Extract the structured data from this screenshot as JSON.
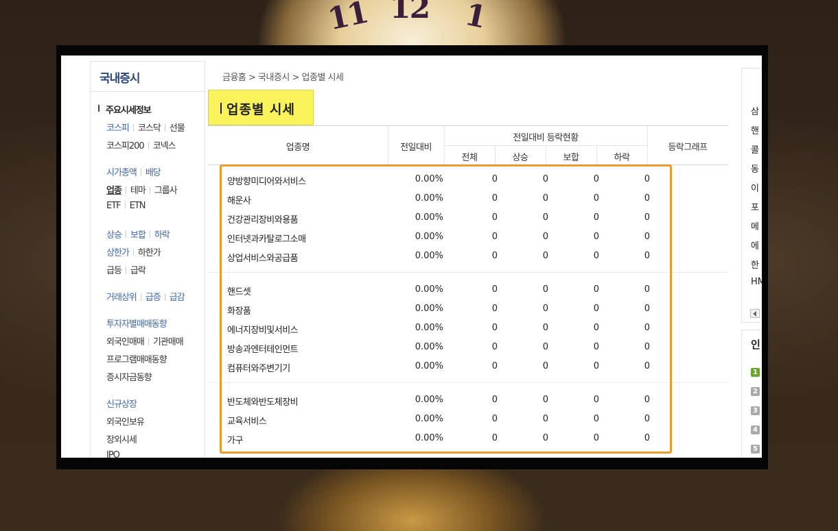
{
  "background": {
    "clock_numerals": [
      "11",
      "12",
      "1"
    ]
  },
  "colors": {
    "accent_blue": "#3b67b0",
    "title_highlight": "#fbf35c",
    "annotation_orange": "#eb9b2d"
  },
  "sidebar": {
    "title": "국내증시",
    "section_head": "주요시세정보",
    "groups": [
      [
        [
          "코스피",
          "코스닥",
          "선물"
        ],
        [
          "코스피200",
          "코넥스"
        ]
      ],
      [
        [
          "시가총액",
          "배당"
        ],
        [
          "업종",
          "테마",
          "그룹사"
        ],
        [
          "ETF",
          "ETN"
        ]
      ],
      [
        [
          "상승",
          "보합",
          "하락"
        ],
        [
          "상한가",
          "하한가"
        ],
        [
          "급등",
          "급락"
        ]
      ],
      [
        [
          "거래상위",
          "급증",
          "급감"
        ]
      ],
      [
        [
          "투자자별매매동향"
        ],
        [
          "외국인매매",
          "기관매매"
        ],
        [
          "프로그램매매동향"
        ],
        [
          "증시자금동향"
        ]
      ],
      [
        [
          "신규상장"
        ],
        [
          "외국인보유"
        ],
        [
          "장외시세"
        ],
        [
          "IPO"
        ]
      ]
    ],
    "selected": "업종"
  },
  "breadcrumb": "금융홈 > 국내증시 > 업종별 시세",
  "page_title": "업종별 시세",
  "table": {
    "headers": {
      "name": "업종명",
      "change": "전일대비",
      "status_group": "전일대비 등락현황",
      "total": "전체",
      "up": "상승",
      "flat": "보합",
      "down": "하락",
      "graph": "등락그래프"
    },
    "groups": [
      [
        {
          "name": "양방향미디어와서비스",
          "change": "0.00%",
          "total": "0",
          "up": "0",
          "flat": "0",
          "down": "0"
        },
        {
          "name": "해운사",
          "change": "0.00%",
          "total": "0",
          "up": "0",
          "flat": "0",
          "down": "0"
        },
        {
          "name": "건강관리장비와용품",
          "change": "0.00%",
          "total": "0",
          "up": "0",
          "flat": "0",
          "down": "0"
        },
        {
          "name": "인터넷과카탈로그소매",
          "change": "0.00%",
          "total": "0",
          "up": "0",
          "flat": "0",
          "down": "0"
        },
        {
          "name": "상업서비스와공급품",
          "change": "0.00%",
          "total": "0",
          "up": "0",
          "flat": "0",
          "down": "0"
        }
      ],
      [
        {
          "name": "핸드셋",
          "change": "0.00%",
          "total": "0",
          "up": "0",
          "flat": "0",
          "down": "0"
        },
        {
          "name": "화장품",
          "change": "0.00%",
          "total": "0",
          "up": "0",
          "flat": "0",
          "down": "0"
        },
        {
          "name": "에너지장비및서비스",
          "change": "0.00%",
          "total": "0",
          "up": "0",
          "flat": "0",
          "down": "0"
        },
        {
          "name": "방송과엔터테인먼트",
          "change": "0.00%",
          "total": "0",
          "up": "0",
          "flat": "0",
          "down": "0"
        },
        {
          "name": "컴퓨터와주변기기",
          "change": "0.00%",
          "total": "0",
          "up": "0",
          "flat": "0",
          "down": "0"
        }
      ],
      [
        {
          "name": "반도체와반도체장비",
          "change": "0.00%",
          "total": "0",
          "up": "0",
          "flat": "0",
          "down": "0"
        },
        {
          "name": "교육서비스",
          "change": "0.00%",
          "total": "0",
          "up": "0",
          "flat": "0",
          "down": "0"
        },
        {
          "name": "가구",
          "change": "0.00%",
          "total": "0",
          "up": "0",
          "flat": "0",
          "down": "0"
        }
      ]
    ]
  },
  "right_panel": {
    "items": [
      "삼",
      "핸",
      "콜",
      "동",
      "이",
      "포",
      "메",
      "에",
      "한",
      "HM"
    ],
    "rank_title": "인",
    "ranks": [
      "1",
      "2",
      "3",
      "4",
      "5"
    ]
  }
}
